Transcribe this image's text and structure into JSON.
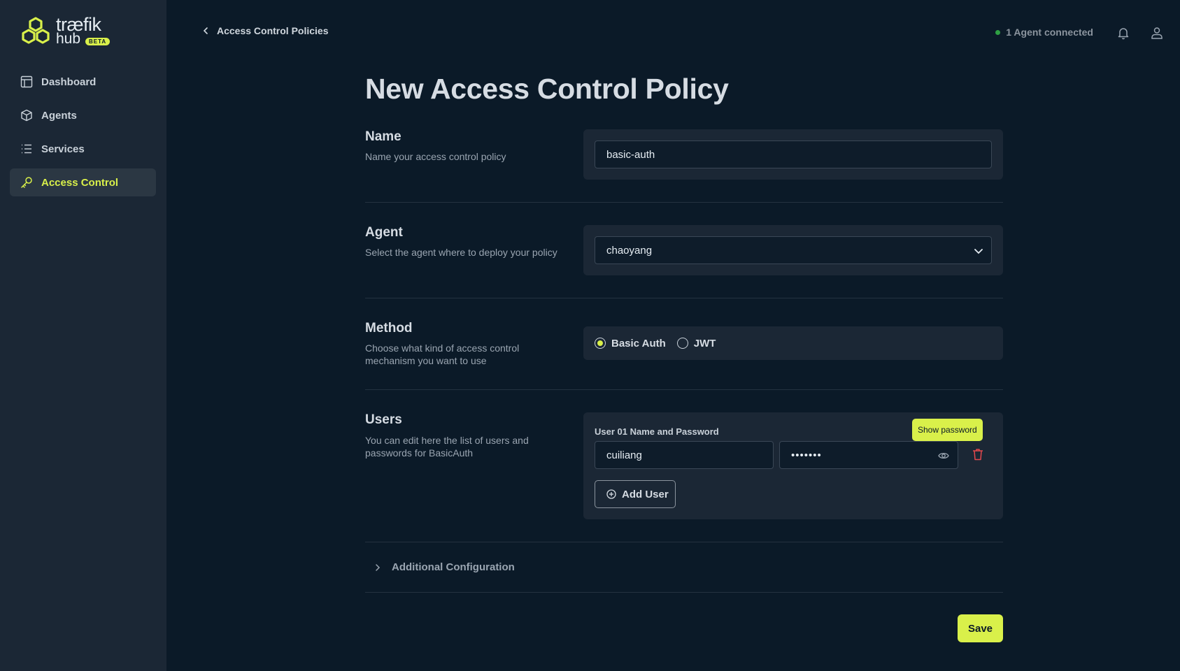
{
  "brand": {
    "name": "træfik",
    "sub": "hub",
    "badge": "BETA",
    "accent": "#d9f04a"
  },
  "sidebar": {
    "items": [
      {
        "label": "Dashboard",
        "icon": "layout-icon",
        "active": false
      },
      {
        "label": "Agents",
        "icon": "box-icon",
        "active": false
      },
      {
        "label": "Services",
        "icon": "list-icon",
        "active": false
      },
      {
        "label": "Access Control",
        "icon": "key-icon",
        "active": true
      }
    ]
  },
  "header": {
    "back_label": "Access Control Policies",
    "agent_status": "1 Agent connected"
  },
  "page": {
    "title": "New Access Control Policy"
  },
  "sections": {
    "name": {
      "title": "Name",
      "desc": "Name your access control policy",
      "value": "basic-auth"
    },
    "agent": {
      "title": "Agent",
      "desc": "Select the agent where to deploy your policy",
      "value": "chaoyang"
    },
    "method": {
      "title": "Method",
      "desc": "Choose what kind of access control mechanism you want to use",
      "options": [
        "Basic Auth",
        "JWT"
      ],
      "selected": "Basic Auth"
    },
    "users": {
      "title": "Users",
      "desc": "You can edit here the list of users and passwords for BasicAuth",
      "user_label": "User 01 Name and Password",
      "username": "cuiliang",
      "password_masked": "•••••••",
      "tooltip": "Show password",
      "add_label": "Add User"
    }
  },
  "additional": {
    "label": "Additional Configuration"
  },
  "save_label": "Save"
}
